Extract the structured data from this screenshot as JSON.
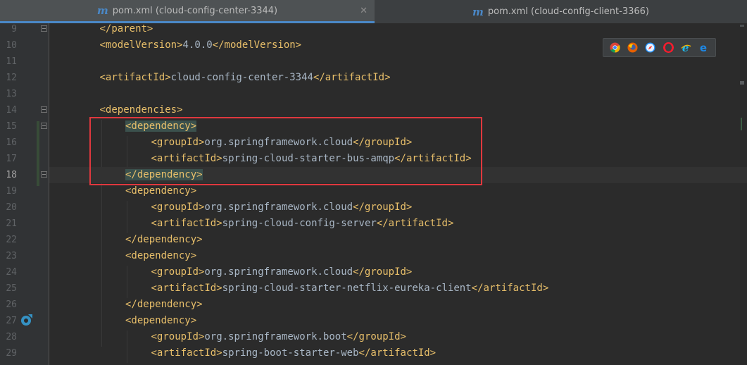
{
  "tabs": [
    {
      "icon": "m",
      "label": "pom.xml (cloud-config-center-3344)",
      "close": "✕"
    },
    {
      "icon": "m",
      "label": "pom.xml (cloud-config-client-3366)"
    }
  ],
  "browsers": [
    "chrome-icon",
    "firefox-icon",
    "safari-icon",
    "opera-icon",
    "ie-icon",
    "edge-icon"
  ],
  "lines": [
    {
      "num": "9",
      "indent": 1,
      "parts": [
        [
          "tg",
          "</parent>"
        ]
      ]
    },
    {
      "num": "10",
      "indent": 1,
      "parts": [
        [
          "tg",
          "<modelVersion>"
        ],
        [
          "tx",
          "4.0.0"
        ],
        [
          "tg",
          "</modelVersion>"
        ]
      ]
    },
    {
      "num": "11",
      "indent": 0,
      "parts": []
    },
    {
      "num": "12",
      "indent": 1,
      "parts": [
        [
          "tg",
          "<artifactId>"
        ],
        [
          "tx",
          "cloud-config-center-3344"
        ],
        [
          "tg",
          "</artifactId>"
        ]
      ]
    },
    {
      "num": "13",
      "indent": 0,
      "parts": []
    },
    {
      "num": "14",
      "indent": 1,
      "parts": [
        [
          "tg",
          "<dependencies>"
        ]
      ]
    },
    {
      "num": "15",
      "indent": 2,
      "parts": [
        [
          "hl",
          "<dependency>"
        ]
      ]
    },
    {
      "num": "16",
      "indent": 3,
      "parts": [
        [
          "tg",
          "<groupId>"
        ],
        [
          "tx",
          "org.springframework.cloud"
        ],
        [
          "tg",
          "</groupId>"
        ]
      ]
    },
    {
      "num": "17",
      "indent": 3,
      "parts": [
        [
          "tg",
          "<artifactId>"
        ],
        [
          "tx",
          "spring-cloud-starter-bus-amqp"
        ],
        [
          "tg",
          "</artifactId>"
        ]
      ]
    },
    {
      "num": "18",
      "indent": 2,
      "parts": [
        [
          "hl",
          "</dependency>"
        ]
      ]
    },
    {
      "num": "19",
      "indent": 2,
      "parts": [
        [
          "tg",
          "<dependency>"
        ]
      ]
    },
    {
      "num": "20",
      "indent": 3,
      "parts": [
        [
          "tg",
          "<groupId>"
        ],
        [
          "tx",
          "org.springframework.cloud"
        ],
        [
          "tg",
          "</groupId>"
        ]
      ]
    },
    {
      "num": "21",
      "indent": 3,
      "parts": [
        [
          "tg",
          "<artifactId>"
        ],
        [
          "tx",
          "spring-cloud-config-server"
        ],
        [
          "tg",
          "</artifactId>"
        ]
      ]
    },
    {
      "num": "22",
      "indent": 2,
      "parts": [
        [
          "tg",
          "</dependency>"
        ]
      ]
    },
    {
      "num": "23",
      "indent": 2,
      "parts": [
        [
          "tg",
          "<dependency>"
        ]
      ]
    },
    {
      "num": "24",
      "indent": 3,
      "parts": [
        [
          "tg",
          "<groupId>"
        ],
        [
          "tx",
          "org.springframework.cloud"
        ],
        [
          "tg",
          "</groupId>"
        ]
      ]
    },
    {
      "num": "25",
      "indent": 3,
      "parts": [
        [
          "tg",
          "<artifactId>"
        ],
        [
          "tx",
          "spring-cloud-starter-netflix-eureka-client"
        ],
        [
          "tg",
          "</artifactId>"
        ]
      ]
    },
    {
      "num": "26",
      "indent": 2,
      "parts": [
        [
          "tg",
          "</dependency>"
        ]
      ]
    },
    {
      "num": "27",
      "indent": 2,
      "parts": [
        [
          "tg",
          "<dependency>"
        ]
      ]
    },
    {
      "num": "28",
      "indent": 3,
      "parts": [
        [
          "tg",
          "<groupId>"
        ],
        [
          "tx",
          "org.springframework.boot"
        ],
        [
          "tg",
          "</groupId>"
        ]
      ]
    },
    {
      "num": "29",
      "indent": 3,
      "parts": [
        [
          "tg",
          "<artifactId>"
        ],
        [
          "tx",
          "spring-boot-starter-web"
        ],
        [
          "tg",
          "</artifactId>"
        ]
      ]
    }
  ],
  "current_line": "18",
  "colors": {
    "tag": "#e8bf6a",
    "text": "#a9b7c6",
    "highlight": "#3b514d",
    "annotation_box": "#e0383e",
    "accent": "#4a88c7"
  }
}
